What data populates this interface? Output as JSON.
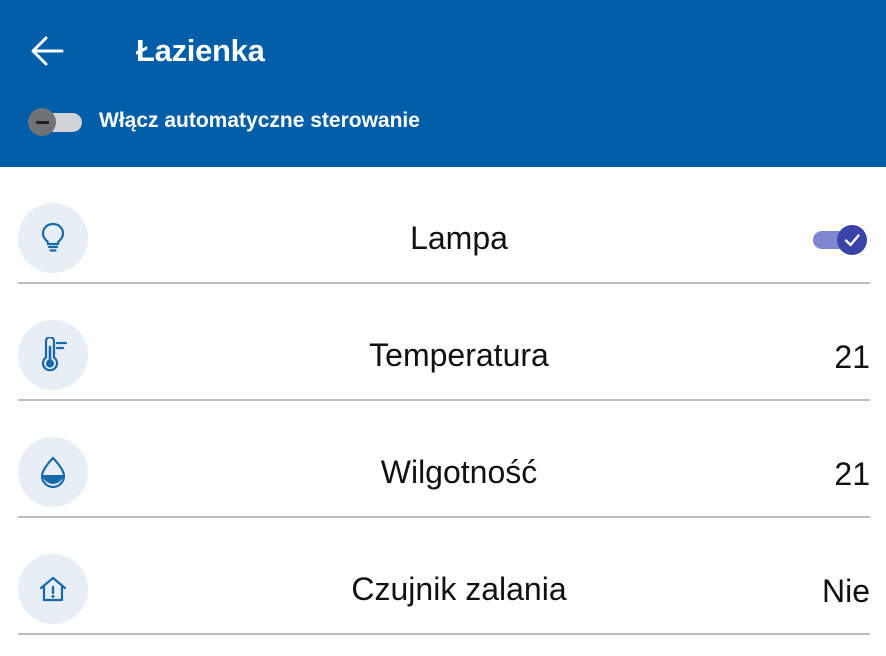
{
  "header": {
    "title": "Łazienka",
    "back_icon": "arrow-left-icon",
    "auto_control": {
      "label": "Włącz automatyczne sterowanie",
      "enabled": false
    }
  },
  "items": [
    {
      "icon": "lightbulb-icon",
      "label": "Lampa",
      "control": "toggle",
      "on": true
    },
    {
      "icon": "thermometer-icon",
      "label": "Temperatura",
      "value": "21"
    },
    {
      "icon": "water-drop-icon",
      "label": "Wilgotność",
      "value": "21"
    },
    {
      "icon": "home-alert-icon",
      "label": "Czujnik zalania",
      "value": "Nie"
    }
  ],
  "colors": {
    "appbar": "#005ea8",
    "icon_circle": "#e7eef6",
    "icon": "#1769aa",
    "toggle_on": "#3a43a8"
  }
}
